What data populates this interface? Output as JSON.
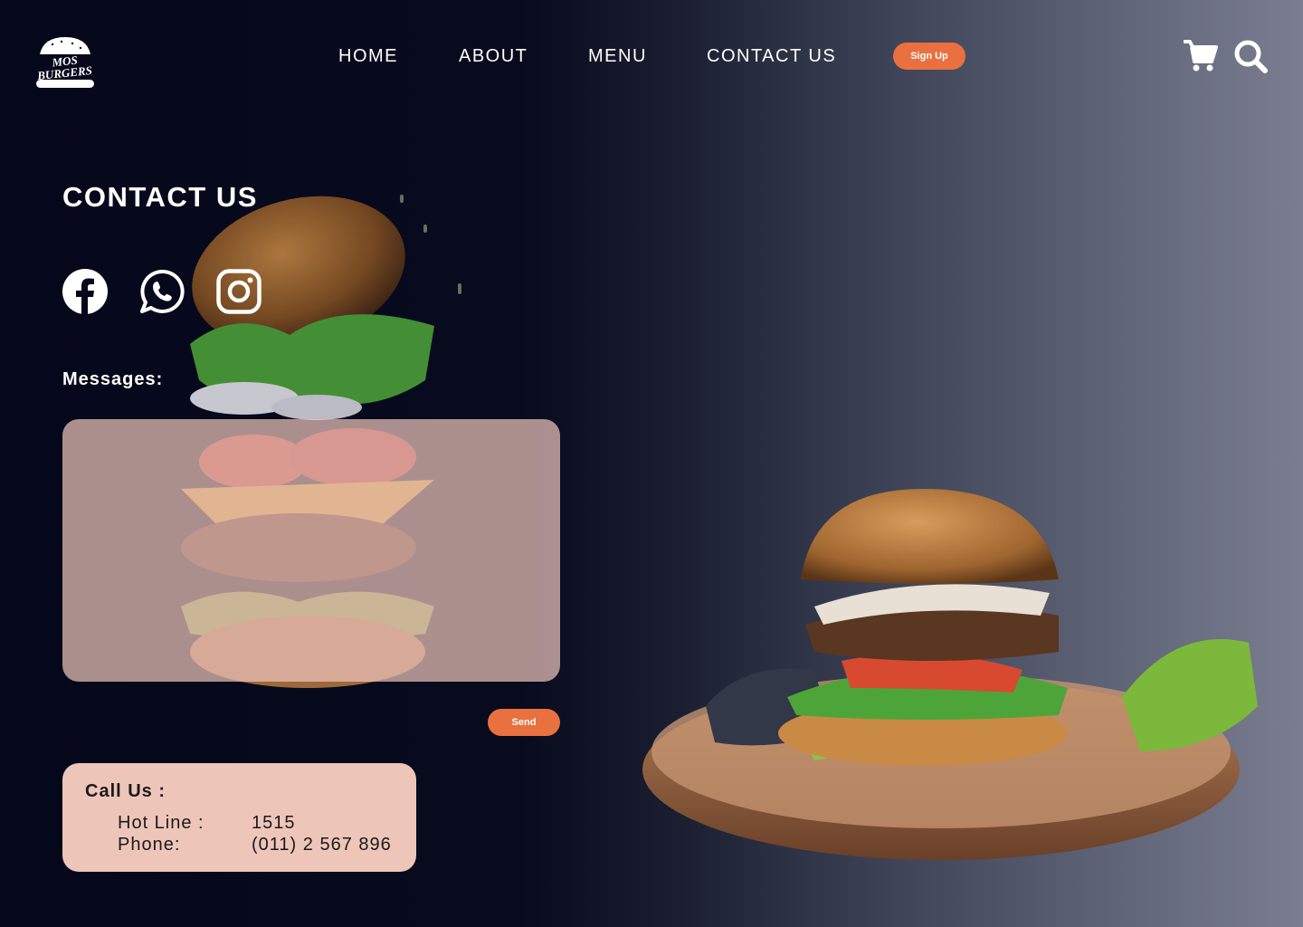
{
  "brand": {
    "logo_line1": "MOS",
    "logo_line2": "BURGERS"
  },
  "nav": {
    "items": [
      {
        "label": "HOME"
      },
      {
        "label": "ABOUT"
      },
      {
        "label": "MENU"
      },
      {
        "label": "CONTACT US"
      }
    ],
    "signup_label": "Sign Up",
    "icons": [
      "cart-icon",
      "search-icon"
    ]
  },
  "main": {
    "title": "CONTACT US",
    "social": [
      "facebook-icon",
      "whatsapp-icon",
      "instagram-icon"
    ],
    "messages_label": "Messages:",
    "message_value": "",
    "send_label": "Send"
  },
  "call": {
    "title": "Call Us :",
    "rows": [
      {
        "label": "Hot Line :",
        "value": "1515"
      },
      {
        "label": "Phone:",
        "value": "(011) 2 567 896"
      }
    ]
  },
  "colors": {
    "accent": "#e9703f",
    "card": "#eec6b9",
    "message_box": "#ebc3ba",
    "background_dark": "#05081a",
    "background_light": "#7a7e90"
  }
}
